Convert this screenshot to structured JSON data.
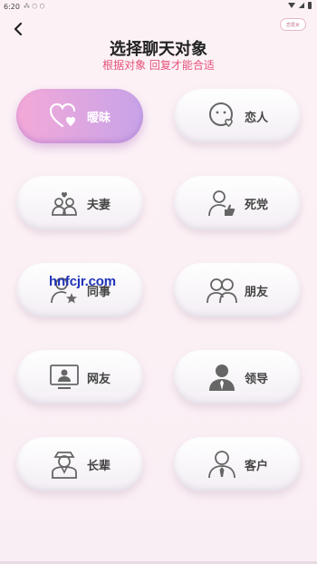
{
  "status_bar": {
    "time": "6:20"
  },
  "header": {
    "back_icon": "chevron-left-icon",
    "pill_text": "恋爱女",
    "title": "选择聊天对象",
    "subtitle": "根据对象 回复才能合适"
  },
  "options": [
    {
      "label": "暧昧",
      "icon": "heart-hand-icon",
      "selected": true
    },
    {
      "label": "恋人",
      "icon": "lover-face-icon",
      "selected": false
    },
    {
      "label": "夫妻",
      "icon": "couple-icon",
      "selected": false
    },
    {
      "label": "死党",
      "icon": "person-thumbs-up-icon",
      "selected": false
    },
    {
      "label": "同事",
      "icon": "person-star-icon",
      "selected": false
    },
    {
      "label": "朋友",
      "icon": "two-people-icon",
      "selected": false
    },
    {
      "label": "网友",
      "icon": "monitor-person-icon",
      "selected": false
    },
    {
      "label": "领导",
      "icon": "boss-icon",
      "selected": false
    },
    {
      "label": "长辈",
      "icon": "elder-icon",
      "selected": false
    },
    {
      "label": "客户",
      "icon": "client-tie-icon",
      "selected": false
    }
  ],
  "watermark": "hnfcjr.com",
  "colors": {
    "accent_pink": "#e6517a",
    "active_gradient_start": "#f4a9d8",
    "active_gradient_end": "#c7a3e8",
    "watermark": "#1f33b8"
  }
}
